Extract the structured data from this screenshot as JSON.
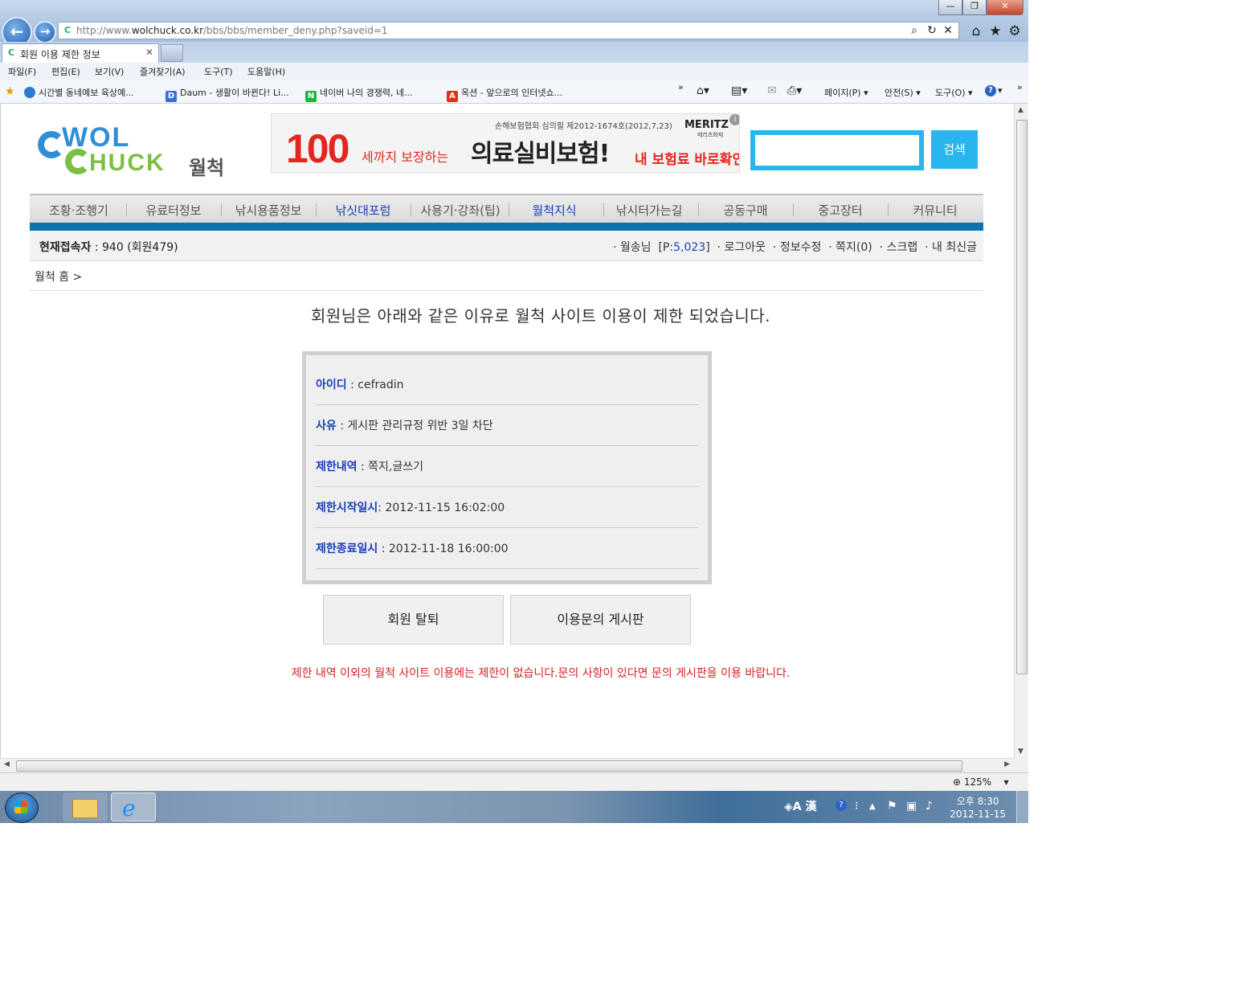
{
  "browser": {
    "url_prefix": "http://www.",
    "url_domain": "wolchuck.co.kr",
    "url_path": "/bbs/bbs/member_deny.php?saveid=1",
    "tab_title": "회원 이용 제한 정보",
    "window_buttons": [
      "—",
      "❐",
      "✕"
    ],
    "menu": [
      "파일(F)",
      "편집(E)",
      "보기(V)",
      "즐겨찾기(A)",
      "도구(T)",
      "도움말(H)"
    ],
    "favorites": [
      {
        "label": "시간별  동네예보  육상예...",
        "icon": "globe-icon"
      },
      {
        "label": "Daum - 생활이 바뀐다! Li...",
        "icon": "daum-icon"
      },
      {
        "label": "네이버  나의 경쟁력, 네...",
        "icon": "naver-icon"
      },
      {
        "label": "옥션 - 앞으로의 인터넷쇼...",
        "icon": "auction-icon"
      }
    ],
    "commands": [
      "페이지(P)",
      "안전(S)",
      "도구(O)"
    ],
    "zoom": "125%"
  },
  "site": {
    "logo_line1": "WOL",
    "logo_line2": "HUCK",
    "logo_korean": "월척",
    "banner": {
      "top_text": "손해보험협회 심의필 제2012-1674호(2012,7,23)",
      "brand": "MERITZ",
      "brand_sub": "메리츠화재",
      "number": "100",
      "sub1": "세까지 보장하는",
      "main": "의료실비보험!",
      "cta": "내 보험료 바로확인"
    },
    "search_button": "검색",
    "nav": [
      "조황·조행기",
      "유료터정보",
      "낚시용품정보",
      "낚싯대포럼",
      "사용기·강좌(팁)",
      "월척지식",
      "낚시터가는길",
      "공동구매",
      "중고장터",
      "커뮤니티"
    ],
    "nav_active": [
      "낚싯대포럼",
      "월척지식"
    ],
    "online_label": "현재접속자",
    "online_value": " : 940 (회원479)",
    "user_name": "월송님",
    "user_points_prefix": "[P:",
    "user_points": "5,023",
    "user_points_suffix": "]",
    "user_links": [
      "로그아웃",
      "정보수정",
      "쪽지(0)",
      "스크랩",
      "내 최신글"
    ],
    "breadcrumb": "월척 홈 >"
  },
  "content": {
    "headline": "회원님은 아래와 같은 이유로 월척 사이트 이용이 제한 되었습니다.",
    "rows": [
      {
        "label": "아이디",
        "value": " : cefradin"
      },
      {
        "label": "사유",
        "value": " : 게시판 관리규정 위반 3일 차단"
      },
      {
        "label": "제한내역",
        "value": " : 쪽지,글쓰기"
      },
      {
        "label": "제한시작일시",
        "value": ": 2012-11-15 16:02:00"
      },
      {
        "label": "제한종료일시",
        "value": " : 2012-11-18 16:00:00"
      }
    ],
    "button_withdraw": "회원 탈퇴",
    "button_inquiry": "이용문의 게시판",
    "notice": "제한 내역 이외의 월척 사이트 이용에는 제한이 없습니다.문의 사항이 있다면 문의 게시판을 이용 바랍니다."
  },
  "taskbar": {
    "time": "오후 8:30",
    "date": "2012-11-15",
    "ime": "A 漢"
  }
}
